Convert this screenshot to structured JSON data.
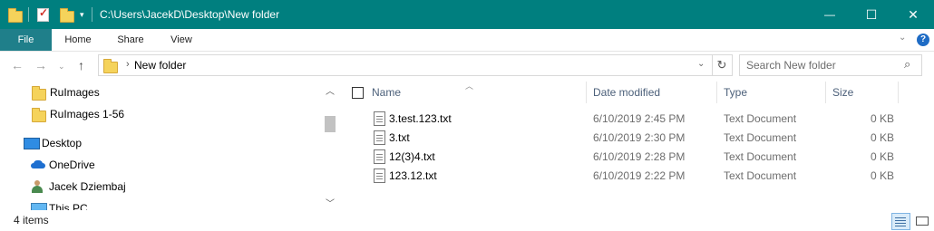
{
  "title_bar": {
    "path": "C:\\Users\\JacekD\\Desktop\\New folder",
    "minimize_glyph": "—",
    "maximize_glyph": "☐",
    "close_glyph": "✕"
  },
  "ribbon": {
    "tabs": [
      "File",
      "Home",
      "Share",
      "View"
    ],
    "help_glyph": "?"
  },
  "address_bar": {
    "breadcrumb": "New folder",
    "search_placeholder": "Search New folder"
  },
  "navigation": {
    "items": [
      {
        "label": "RuImages",
        "icon": "folder-icon"
      },
      {
        "label": "RuImages 1-56",
        "icon": "folder-icon"
      },
      {
        "label": "Desktop",
        "icon": "desktop-icon"
      },
      {
        "label": "OneDrive",
        "icon": "onedrive-icon"
      },
      {
        "label": "Jacek Dziembaj",
        "icon": "user-icon"
      },
      {
        "label": "This PC",
        "icon": "this-pc-icon"
      }
    ]
  },
  "file_list": {
    "columns": [
      "Name",
      "Date modified",
      "Type",
      "Size"
    ],
    "rows": [
      {
        "name": "3.test.123.txt",
        "date": "6/10/2019 2:45 PM",
        "type": "Text Document",
        "size": "0 KB"
      },
      {
        "name": "3.txt",
        "date": "6/10/2019 2:30 PM",
        "type": "Text Document",
        "size": "0 KB"
      },
      {
        "name": "12(3)4.txt",
        "date": "6/10/2019 2:28 PM",
        "type": "Text Document",
        "size": "0 KB"
      },
      {
        "name": "123.12.txt",
        "date": "6/10/2019 2:22 PM",
        "type": "Text Document",
        "size": "0 KB"
      }
    ]
  },
  "status_bar": {
    "item_count": "4 items"
  },
  "colors": {
    "titlebar": "#007f7f",
    "file_tab": "#1f7f8a",
    "folder": "#f5d35b"
  }
}
